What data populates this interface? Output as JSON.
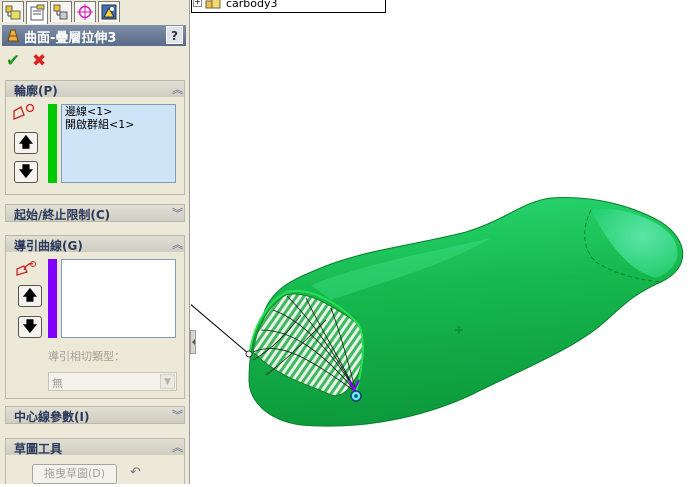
{
  "panel": {
    "tabs": [
      {
        "icon": "feature-manager-icon"
      },
      {
        "icon": "property-manager-icon"
      },
      {
        "icon": "configuration-manager-icon"
      },
      {
        "icon": "dimxpert-icon"
      },
      {
        "icon": "display-manager-icon"
      }
    ],
    "title": "曲面-疊層拉伸3",
    "help_label": "?",
    "ok_symbol": "✔",
    "cancel_symbol": "✖",
    "profiles": {
      "label": "輪廓(P)",
      "items": [
        "邊線<1>",
        "開啟群組<1>"
      ],
      "up_symbol": "🡅",
      "down_symbol": "🡇",
      "color": "#00c800"
    },
    "start_end": {
      "label": "起始/終止限制(C)"
    },
    "guides": {
      "label": "導引曲線(G)",
      "color": "#8000ff",
      "up_symbol": "🡅",
      "down_symbol": "🡇",
      "tangency_label": "導引相切類型：",
      "tangency_value": "無"
    },
    "centerline": {
      "label": "中心線參數(I)"
    },
    "sketch_tools": {
      "label": "草圖工具",
      "drag_sketch_label": "拖曳草圖(D)",
      "undo_symbol": "↶"
    }
  },
  "tree": {
    "expander": "+",
    "item_label": "carbody3"
  },
  "viewport": {
    "body_color": "#22d060",
    "highlight_color": "#7ef0b8"
  }
}
